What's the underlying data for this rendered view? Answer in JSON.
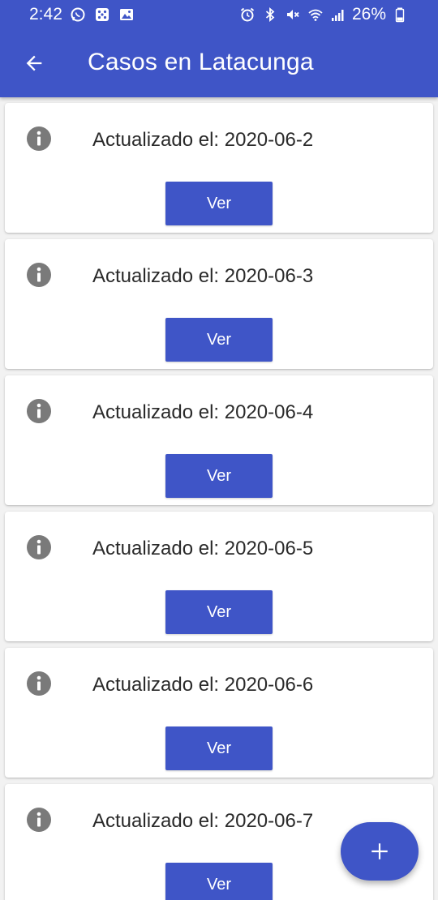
{
  "status_bar": {
    "time": "2:42",
    "battery": "26%",
    "left_icons": [
      "whatsapp-icon",
      "dice-icon",
      "image-icon"
    ],
    "right_icons": [
      "alarm-icon",
      "bluetooth-icon",
      "mute-icon",
      "wifi-icon",
      "signal-icon",
      "battery-icon"
    ]
  },
  "toolbar": {
    "title": "Casos en Latacunga",
    "back_icon": "arrow-back-icon"
  },
  "cards": [
    {
      "label": "Actualizado el: 2020-06-2",
      "button_label": "Ver"
    },
    {
      "label": "Actualizado el: 2020-06-3",
      "button_label": "Ver"
    },
    {
      "label": "Actualizado el: 2020-06-4",
      "button_label": "Ver"
    },
    {
      "label": "Actualizado el: 2020-06-5",
      "button_label": "Ver"
    },
    {
      "label": "Actualizado el: 2020-06-6",
      "button_label": "Ver"
    },
    {
      "label": "Actualizado el: 2020-06-7",
      "button_label": "Ver"
    }
  ],
  "fab": {
    "icon": "plus-icon"
  },
  "colors": {
    "primary": "#3f55c7",
    "info_icon": "#7a7a7a",
    "text": "#2a2a2a",
    "background": "#f2f2f2"
  }
}
